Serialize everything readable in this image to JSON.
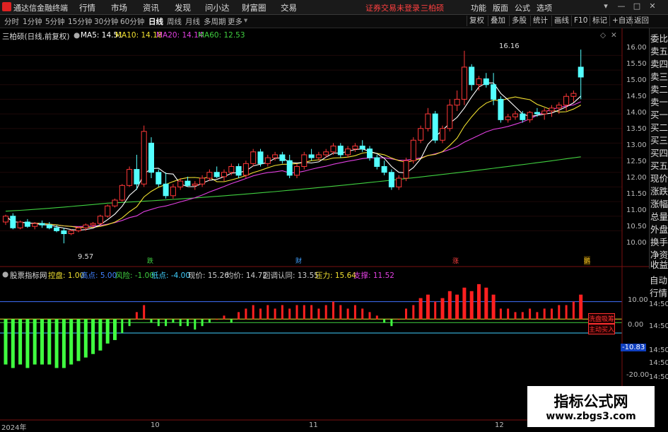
{
  "app": {
    "title": "通达信金融终端",
    "menu": [
      "行情",
      "市场",
      "资讯",
      "发现",
      "问小达",
      "财富圈",
      "交易"
    ],
    "notice": "证券交易未登录",
    "stock_name": "三柏硕",
    "right_menu": [
      "功能",
      "版面",
      "公式",
      "选项"
    ],
    "window_buttons": [
      "▾",
      "—",
      "□",
      "✕"
    ]
  },
  "toolbar": {
    "periods": [
      "分时",
      "1分钟",
      "5分钟",
      "15分钟",
      "30分钟",
      "60分钟",
      "日线",
      "周线",
      "月线",
      "多周期",
      "更多"
    ],
    "active_period": "日线",
    "buttons": [
      "复权",
      "叠加",
      "多股",
      "统计",
      "画线",
      "F10",
      "标记",
      "+自选",
      "返回"
    ]
  },
  "info_line": {
    "title": "三柏硕(日线,前复权)",
    "ma5": "MA5: 14.51",
    "ma10": "MA10: 14.18",
    "ma20": "MA20: 14.14",
    "ma60": "MA60: 12.53",
    "colors": {
      "ma5": "#ffffff",
      "ma10": "#f0e030",
      "ma20": "#e040e0",
      "ma60": "#40d040"
    }
  },
  "price_axis": [
    "16.00",
    "15.50",
    "15.00",
    "14.50",
    "14.00",
    "13.50",
    "13.00",
    "12.50",
    "12.00",
    "11.50",
    "11.00",
    "10.50",
    "10.00"
  ],
  "annotations": {
    "high": "16.16",
    "low": "9.57"
  },
  "markers": [
    {
      "label": "跌",
      "color": "#40d040"
    },
    {
      "label": "财",
      "color": "#40a0ff"
    },
    {
      "label": "涨",
      "color": "#ff4040"
    },
    {
      "label": "鹅",
      "color": "#f0c020"
    }
  ],
  "right_panel": {
    "quote_labels": [
      "委比",
      "卖五",
      "卖四",
      "卖三",
      "卖二",
      "卖一",
      "买一",
      "买二",
      "买三",
      "买四",
      "买五",
      "现价",
      "涨跌",
      "涨幅",
      "总量",
      "外盘",
      "换手",
      "净资",
      "收益"
    ],
    "lower_labels": [
      "自动",
      "行情"
    ]
  },
  "indicator": {
    "name": "股票指标网",
    "items": [
      {
        "text": "控盘: 1.00",
        "color": "#f0e030"
      },
      {
        "text": "高点: 5.00",
        "color": "#4080ff"
      },
      {
        "text": "风险: -1.00",
        "color": "#40d040"
      },
      {
        "text": "低点: -4.00",
        "color": "#40d0ff"
      },
      {
        "text": "现价: 15.26",
        "color": "#cccccc"
      },
      {
        "text": "均价: 14.72",
        "color": "#cccccc"
      },
      {
        "text": "回调认同: 13.55",
        "color": "#cccccc"
      },
      {
        "text": "压力: 15.64",
        "color": "#f0e030"
      },
      {
        "text": "支撑: 11.52",
        "color": "#e040e0"
      }
    ],
    "axis": [
      "10.00",
      "14:50",
      "0.00",
      "14:50",
      "-10.83",
      "14:50",
      "14:50",
      "-20.00",
      "14:50"
    ],
    "current_value": "-10.83",
    "tags": [
      "洗盘吸筹",
      "主动买入"
    ]
  },
  "x_axis": [
    "2024年",
    "10",
    "11",
    "12"
  ],
  "watermark": {
    "title": "指标公式网",
    "url": "www.zbgs3.com"
  },
  "chart_data": {
    "type": "candlestick",
    "price_range": [
      9.55,
      16.3
    ],
    "candles": [
      [
        10.3,
        10.55,
        10.2,
        10.5
      ],
      [
        10.5,
        10.6,
        10.05,
        10.1
      ],
      [
        10.1,
        10.35,
        10.05,
        10.3
      ],
      [
        10.3,
        10.4,
        10.1,
        10.15
      ],
      [
        10.15,
        10.3,
        10.05,
        10.25
      ],
      [
        10.25,
        10.35,
        10.1,
        10.2
      ],
      [
        10.2,
        10.3,
        10.05,
        10.1
      ],
      [
        10.1,
        10.2,
        9.95,
        10.0
      ],
      [
        10.0,
        10.1,
        9.57,
        9.9
      ],
      [
        9.9,
        10.05,
        9.85,
        10.0
      ],
      [
        10.0,
        10.15,
        9.95,
        10.1
      ],
      [
        10.1,
        10.25,
        10.0,
        10.2
      ],
      [
        10.2,
        10.3,
        10.1,
        10.25
      ],
      [
        10.25,
        10.55,
        10.2,
        10.5
      ],
      [
        10.5,
        10.9,
        10.45,
        10.85
      ],
      [
        10.85,
        11.1,
        10.8,
        11.05
      ],
      [
        11.05,
        11.6,
        11.0,
        11.55
      ],
      [
        11.55,
        12.2,
        11.5,
        12.1
      ],
      [
        12.1,
        12.6,
        11.4,
        11.6
      ],
      [
        11.6,
        13.6,
        11.5,
        13.4
      ],
      [
        13.0,
        13.2,
        11.8,
        12.0
      ],
      [
        12.0,
        12.1,
        11.5,
        11.6
      ],
      [
        11.6,
        12.0,
        11.1,
        11.2
      ],
      [
        11.2,
        11.6,
        11.1,
        11.5
      ],
      [
        11.5,
        11.8,
        11.4,
        11.7
      ],
      [
        11.7,
        11.85,
        11.5,
        11.55
      ],
      [
        11.55,
        11.7,
        11.4,
        11.6
      ],
      [
        11.6,
        11.9,
        11.5,
        11.8
      ],
      [
        11.8,
        12.1,
        11.7,
        12.0
      ],
      [
        12.0,
        12.2,
        11.8,
        11.85
      ],
      [
        11.85,
        12.1,
        11.7,
        12.0
      ],
      [
        12.0,
        12.3,
        11.9,
        12.2
      ],
      [
        12.2,
        12.3,
        11.8,
        11.9
      ],
      [
        11.9,
        12.4,
        11.8,
        12.3
      ],
      [
        12.3,
        12.8,
        12.2,
        12.7
      ],
      [
        12.7,
        12.8,
        12.2,
        12.3
      ],
      [
        12.3,
        12.6,
        12.2,
        12.5
      ],
      [
        12.5,
        12.7,
        12.4,
        12.6
      ],
      [
        12.6,
        12.7,
        12.3,
        12.4
      ],
      [
        12.4,
        12.6,
        11.8,
        11.9
      ],
      [
        11.9,
        12.3,
        11.8,
        12.2
      ],
      [
        12.2,
        12.7,
        12.1,
        12.6
      ],
      [
        12.6,
        12.8,
        12.4,
        12.5
      ],
      [
        12.5,
        12.7,
        12.4,
        12.6
      ],
      [
        12.6,
        12.8,
        12.5,
        12.7
      ],
      [
        12.7,
        13.0,
        12.6,
        12.9
      ],
      [
        12.9,
        13.0,
        12.5,
        12.6
      ],
      [
        12.6,
        12.9,
        12.5,
        12.8
      ],
      [
        12.8,
        13.0,
        12.7,
        12.9
      ],
      [
        12.9,
        13.1,
        12.7,
        12.8
      ],
      [
        12.8,
        12.9,
        12.4,
        12.5
      ],
      [
        12.5,
        12.6,
        12.1,
        12.2
      ],
      [
        12.2,
        12.4,
        11.9,
        12.0
      ],
      [
        12.0,
        12.1,
        11.4,
        11.5
      ],
      [
        11.5,
        11.9,
        11.4,
        11.8
      ],
      [
        11.8,
        12.5,
        11.7,
        12.4
      ],
      [
        12.4,
        13.2,
        12.3,
        13.1
      ],
      [
        13.1,
        13.6,
        13.0,
        13.5
      ],
      [
        13.5,
        14.2,
        13.4,
        14.0
      ],
      [
        14.0,
        14.1,
        13.0,
        13.1
      ],
      [
        13.1,
        13.6,
        13.0,
        13.5
      ],
      [
        13.5,
        14.5,
        13.4,
        14.3
      ],
      [
        14.3,
        14.8,
        14.1,
        14.5
      ],
      [
        14.5,
        16.16,
        14.3,
        15.6
      ],
      [
        15.6,
        15.7,
        14.8,
        15.0
      ],
      [
        15.0,
        15.3,
        14.8,
        15.2
      ],
      [
        15.2,
        15.4,
        14.9,
        15.0
      ],
      [
        15.0,
        15.4,
        14.3,
        14.5
      ],
      [
        14.5,
        14.6,
        13.7,
        13.8
      ],
      [
        13.8,
        14.0,
        13.7,
        13.9
      ],
      [
        13.9,
        14.1,
        13.8,
        14.0
      ],
      [
        14.0,
        14.1,
        13.7,
        13.8
      ],
      [
        13.8,
        14.1,
        13.7,
        14.05
      ],
      [
        14.05,
        14.2,
        13.9,
        14.0
      ],
      [
        14.0,
        14.2,
        13.8,
        14.1
      ],
      [
        14.1,
        14.3,
        13.9,
        14.2
      ],
      [
        14.2,
        14.4,
        14.0,
        14.3
      ],
      [
        14.3,
        14.7,
        14.1,
        14.6
      ],
      [
        14.6,
        14.8,
        14.4,
        14.7
      ],
      [
        15.6,
        16.2,
        14.5,
        15.26
      ]
    ],
    "ma60_start": 10.75,
    "ma60_end": 12.53,
    "indicator_values": [
      -13,
      -14,
      -13,
      -14,
      -13,
      -13,
      -13,
      -14,
      -14,
      -13,
      -12,
      -11,
      -10,
      -9,
      -7,
      -6,
      -4,
      -2,
      2,
      4,
      -1,
      -2,
      -2,
      -1,
      -2,
      -2,
      -3,
      -2,
      -1,
      0,
      1,
      -1,
      2,
      3,
      4,
      3,
      4,
      3,
      4,
      3,
      4,
      4,
      4,
      3,
      4,
      5,
      4,
      3,
      4,
      3,
      2,
      1,
      -1,
      -2,
      0,
      3,
      4,
      6,
      7,
      5,
      6,
      8,
      7,
      9,
      8,
      10,
      9,
      7,
      3,
      3,
      2,
      2,
      3,
      2,
      3,
      3,
      4,
      4,
      5,
      7
    ],
    "indicator_range": [
      -22,
      12
    ],
    "lines": {
      "high": 5.0,
      "low": -4.0
    }
  }
}
